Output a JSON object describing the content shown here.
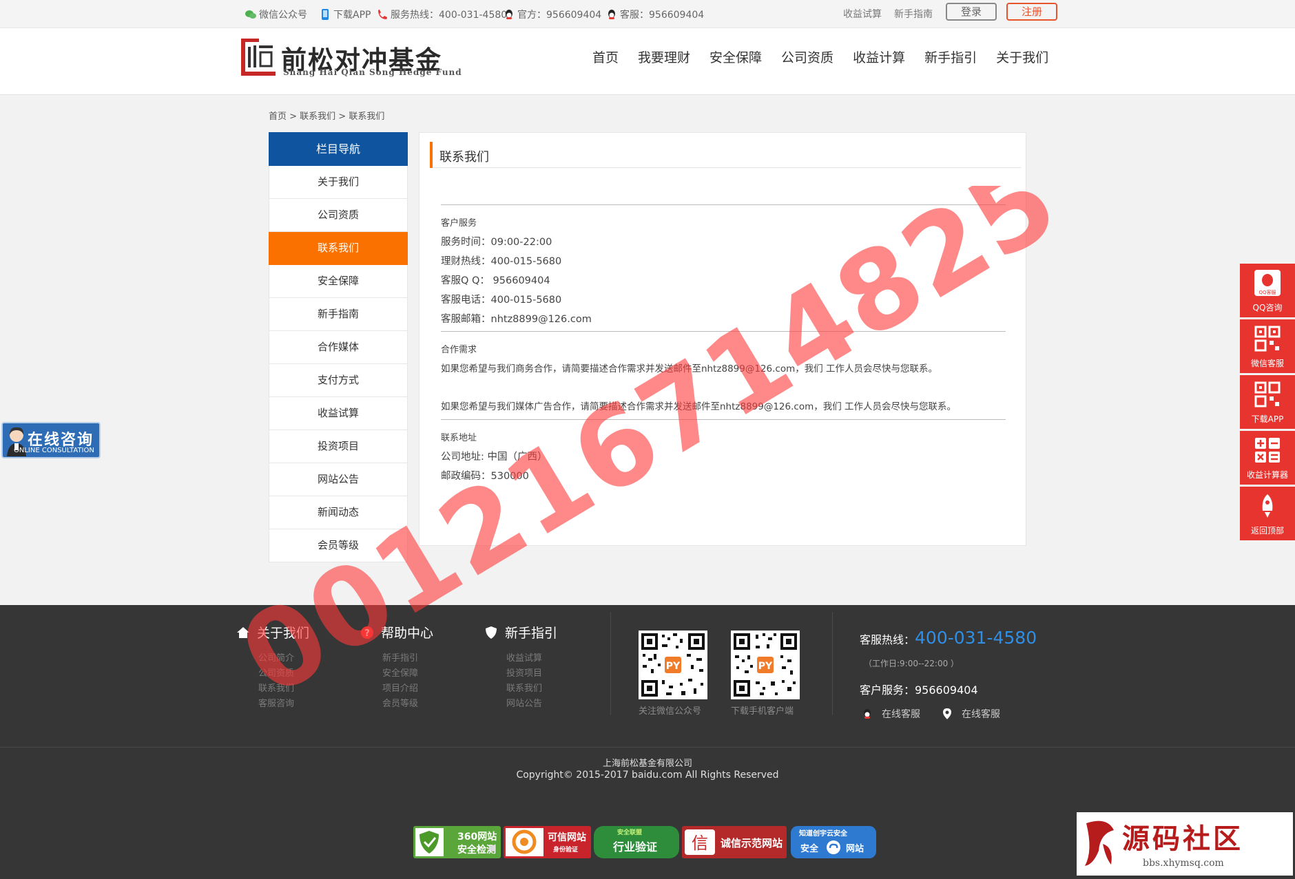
{
  "topbar": {
    "wechat": "微信公众号",
    "app": "下载APP",
    "hotline": "服务热线：400-031-4580",
    "official": "官方：956609404",
    "service": "客服：956609404",
    "calc": "收益试算",
    "guide": "新手指南",
    "login": "登录",
    "register": "注册"
  },
  "header": {
    "logo_text": "前松对冲基金",
    "logo_sub": "Shang Hai Qian Song Hedge Fund",
    "nav": [
      "首页",
      "我要理财",
      "安全保障",
      "公司资质",
      "收益计算",
      "新手指引",
      "关于我们"
    ]
  },
  "breadcrumb": "首页 > 联系我们 > 联系我们",
  "sidebar": {
    "title": "栏目导航",
    "items": [
      "关于我们",
      "公司资质",
      "联系我们",
      "安全保障",
      "新手指南",
      "合作媒体",
      "支付方式",
      "收益试算",
      "投资项目",
      "网站公告",
      "新闻动态",
      "会员等级"
    ],
    "active_index": 2
  },
  "content": {
    "title": "联系我们",
    "s1_head": "客户服务",
    "s1_lines": [
      "服务时间：09:00-22:00",
      "理财热线：400-015-5680",
      "客服Q Q： 956609404",
      "客服电话：400-015-5680",
      "客服邮箱：nhtz8899@126.com"
    ],
    "s2_head": "合作需求",
    "s2_lines": [
      "如果您希望与我们商务合作，请简要描述合作需求并发送邮件至nhtz8899@126.com，我们 工作人员会尽快与您联系。",
      "如果您希望与我们媒体广告合作，请简要描述合作需求并发送邮件至nhtz8899@126.com，我们 工作人员会尽快与您联系。"
    ],
    "s3_head": "联系地址",
    "s3_lines": [
      "公司地址: 中国（广西）",
      "邮政编码：530000"
    ]
  },
  "consult": {
    "cn": "在线咨询",
    "en": "ONLINE CONSULTATION"
  },
  "right_float": [
    "QQ咨询",
    "微信客服",
    "下载APP",
    "收益计算器",
    "返回顶部"
  ],
  "right_float_badge": "QQ客服",
  "footer": {
    "cols": [
      {
        "title": "关于我们",
        "links": [
          "公司简介",
          "公司资质",
          "联系我们",
          "客服咨询"
        ]
      },
      {
        "title": "帮助中心",
        "links": [
          "新手指引",
          "安全保障",
          "项目介绍",
          "会员等级"
        ]
      },
      {
        "title": "新手指引",
        "links": [
          "收益试算",
          "投资项目",
          "联系我们",
          "网站公告"
        ]
      }
    ],
    "qr_captions": [
      "关注微信公众号",
      "下载手机客户端"
    ],
    "hotline_label": "客服热线：",
    "hotline": "400-031-4580",
    "hours": "（工作日:9:00--22:00 ）",
    "service": "客户服务：956609404",
    "online1": "在线客服",
    "online2": "在线客服",
    "company": "上海前松基金有限公司",
    "copyright": "Copyright© 2015-2017 baidu.com All Rights Reserved",
    "badges": [
      "360网站",
      "安全检测",
      "可信网站",
      "身份验证",
      "安全联盟",
      "行业验证",
      "诚信示范网站",
      "知道创宇云安全",
      "安全",
      "网站"
    ]
  },
  "watermark": "001216714825",
  "source_mark": {
    "cn": "源码社区",
    "url": "bbs.xhymsq.com"
  }
}
